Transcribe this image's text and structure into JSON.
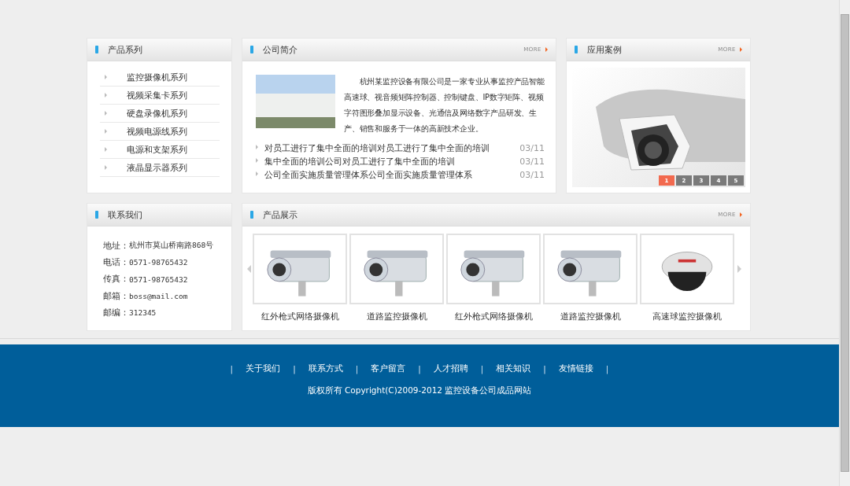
{
  "product_series": {
    "title": "产品系列",
    "items": [
      {
        "label": "监控摄像机系列"
      },
      {
        "label": "视频采集卡系列"
      },
      {
        "label": "硬盘录像机系列"
      },
      {
        "label": "视频电源线系列"
      },
      {
        "label": "电源和支架系列"
      },
      {
        "label": "液晶显示器系列"
      }
    ]
  },
  "company": {
    "title": "公司简介",
    "more": "MORE",
    "intro": "杭州某监控设备有限公司是一家专业从事监控产品智能高速球、视音频矩阵控制器、控制键盘、IP数字矩阵、视频字符图形叠加显示设备、光通信及网络数字产品研发、生产、销售和服务于一体的高新技术企业。",
    "news": [
      {
        "title": "对员工进行了集中全面的培训对员工进行了集中全面的培训",
        "date": "03/11"
      },
      {
        "title": "集中全面的培训公司对员工进行了集中全面的培训",
        "date": "03/11"
      },
      {
        "title": "公司全面实施质量管理体系公司全面实施质量管理体系",
        "date": "03/11"
      }
    ]
  },
  "cases": {
    "title": "应用案例",
    "more": "MORE",
    "pages": [
      {
        "label": "1",
        "selected": true
      },
      {
        "label": "2",
        "selected": false
      },
      {
        "label": "3",
        "selected": false
      },
      {
        "label": "4",
        "selected": false
      },
      {
        "label": "5",
        "selected": false
      }
    ]
  },
  "contact": {
    "title": "联系我们",
    "lines": [
      {
        "label": "地址：",
        "value": "杭州市莫山桥南路868号"
      },
      {
        "label": "电话：",
        "value": "0571-98765432"
      },
      {
        "label": "传真：",
        "value": "0571-98765432"
      },
      {
        "label": "邮箱：",
        "value": "boss@mail.com"
      },
      {
        "label": "邮编：",
        "value": "312345"
      }
    ]
  },
  "products": {
    "title": "产品展示",
    "more": "MORE",
    "items": [
      {
        "caption": "红外枪式网络摄像机",
        "kind": "bullet"
      },
      {
        "caption": "道路监控摄像机",
        "kind": "bullet"
      },
      {
        "caption": "红外枪式网络摄像机",
        "kind": "bullet"
      },
      {
        "caption": "道路监控摄像机",
        "kind": "bullet"
      },
      {
        "caption": "高速球监控摄像机",
        "kind": "dome"
      }
    ]
  },
  "footer": {
    "items": [
      {
        "kind": "separator",
        "text": "|"
      },
      {
        "kind": "link",
        "text": "关于我们"
      },
      {
        "kind": "separator",
        "text": "|"
      },
      {
        "kind": "link",
        "text": "联系方式"
      },
      {
        "kind": "separator",
        "text": "|"
      },
      {
        "kind": "link",
        "text": "客户留言"
      },
      {
        "kind": "separator",
        "text": "|"
      },
      {
        "kind": "link",
        "text": "人才招聘"
      },
      {
        "kind": "separator",
        "text": "|"
      },
      {
        "kind": "link",
        "text": "相关知识"
      },
      {
        "kind": "separator",
        "text": "|"
      },
      {
        "kind": "link",
        "text": "友情链接"
      },
      {
        "kind": "separator",
        "text": "|"
      }
    ],
    "copyright": "版权所有 Copyright(C)2009-2012 监控设备公司成品网站"
  }
}
